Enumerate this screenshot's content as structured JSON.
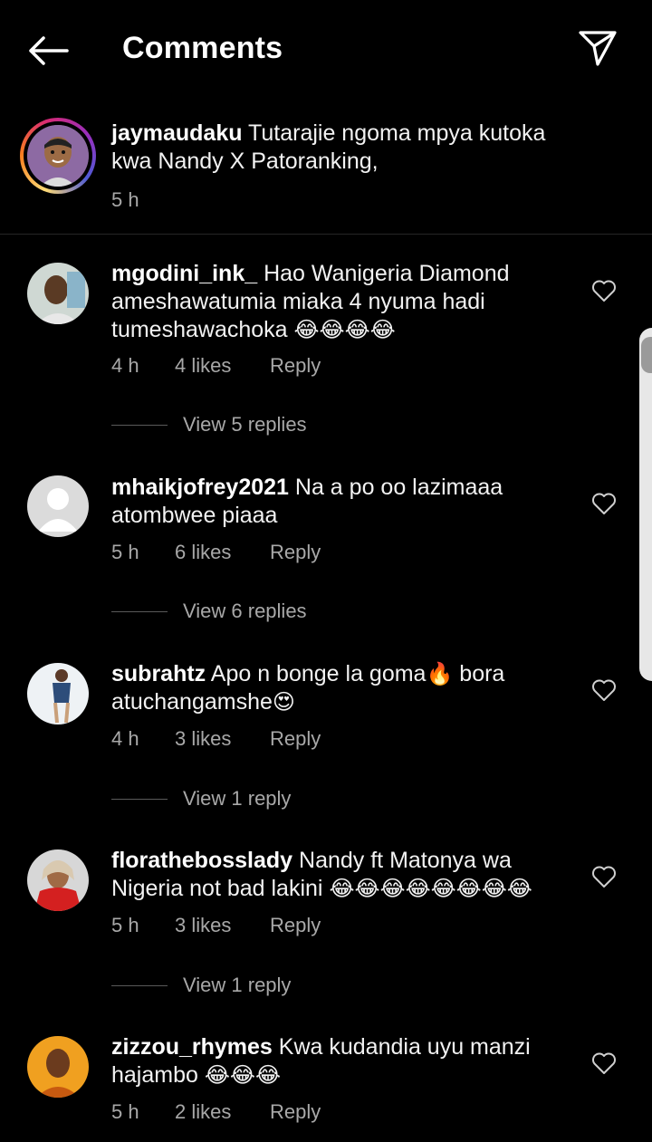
{
  "header": {
    "title": "Comments",
    "back_icon": "arrow-left-icon",
    "share_icon": "paper-plane-icon"
  },
  "caption": {
    "username": "jaymaudaku",
    "text": "Tutarajie ngoma mpya kutoka kwa Nandy X Patoranking,",
    "time": "5 h"
  },
  "comments": [
    {
      "username": "mgodini_ink_",
      "text": "Hao Wanigeria Diamond ameshawatumia miaka 4 nyuma hadi tumeshawachoka",
      "emoji": "😂😂😂😂",
      "time": "4 h",
      "likes": "4 likes",
      "reply": "Reply",
      "view_replies": "View 5 replies"
    },
    {
      "username": "mhaikjofrey2021",
      "text": "Na a po oo lazimaaa atombwee piaaa",
      "emoji": "",
      "time": "5 h",
      "likes": "6 likes",
      "reply": "Reply",
      "view_replies": "View 6 replies"
    },
    {
      "username": "subrahtz",
      "text": "Apo n bonge la goma",
      "text_mid_emoji": "🔥",
      "text_after": "bora atuchangamshe",
      "emoji": "😍",
      "time": "4 h",
      "likes": "3 likes",
      "reply": "Reply",
      "view_replies": "View 1 reply"
    },
    {
      "username": "floratheboss lady",
      "username_display": "floratheboss lady",
      "text": "Nandy ft Matonya wa Nigeria not bad lakini",
      "emoji": "😂😂😂😂😂😂😂😂",
      "time": "5 h",
      "likes": "3 likes",
      "reply": "Reply",
      "view_replies": "View 1 reply"
    },
    {
      "username": "zizzou_rhymes",
      "text": "Kwa kudandia uyu manzi hajambo",
      "emoji": "😂😂😂",
      "time": "5 h",
      "likes": "2 likes",
      "reply": "Reply"
    }
  ]
}
